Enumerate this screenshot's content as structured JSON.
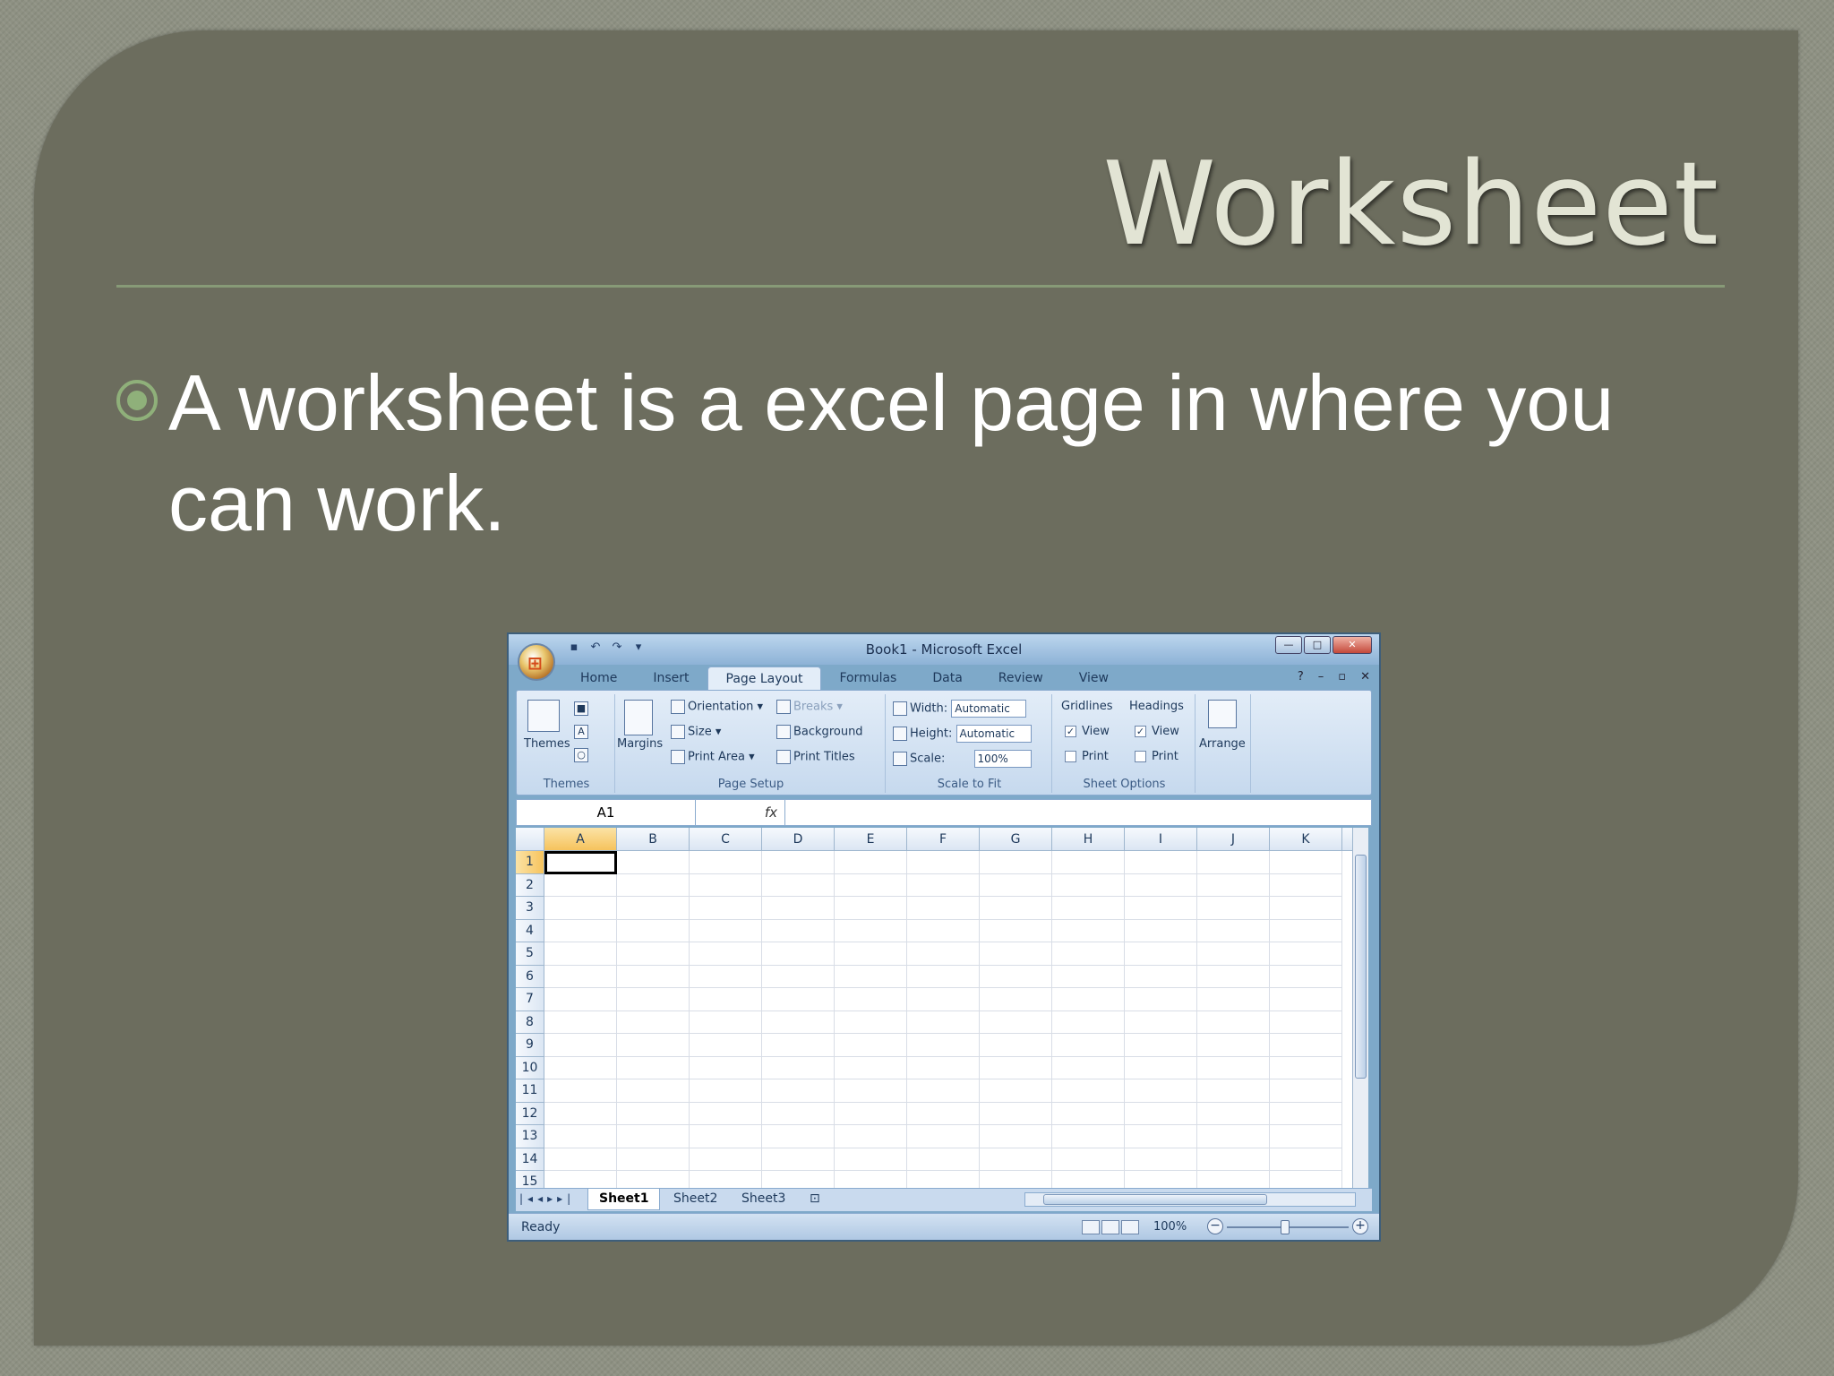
{
  "slide": {
    "title": "Worksheet",
    "bullet_text": "A worksheet is a excel page in where you can work."
  },
  "excel": {
    "window_title": "Book1 - Microsoft Excel",
    "tabs": [
      "Home",
      "Insert",
      "Page Layout",
      "Formulas",
      "Data",
      "Review",
      "View"
    ],
    "active_tab": "Page Layout",
    "ribbon": {
      "themes": {
        "label": "Themes",
        "group": "Themes"
      },
      "page_setup": {
        "margins": "Margins",
        "orientation": "Orientation",
        "size": "Size",
        "print_area": "Print Area",
        "breaks": "Breaks",
        "background": "Background",
        "print_titles": "Print Titles",
        "group": "Page Setup"
      },
      "scale_to_fit": {
        "width_label": "Width:",
        "width_value": "Automatic",
        "height_label": "Height:",
        "height_value": "Automatic",
        "scale_label": "Scale:",
        "scale_value": "100%",
        "group": "Scale to Fit"
      },
      "sheet_options": {
        "gridlines": "Gridlines",
        "headings": "Headings",
        "view": "View",
        "print": "Print",
        "group": "Sheet Options"
      },
      "arrange": {
        "label": "Arrange"
      }
    },
    "name_box": "A1",
    "fx": "fx",
    "columns": [
      "A",
      "B",
      "C",
      "D",
      "E",
      "F",
      "G",
      "H",
      "I",
      "J",
      "K"
    ],
    "rows": [
      "1",
      "2",
      "3",
      "4",
      "5",
      "6",
      "7",
      "8",
      "9",
      "10",
      "11",
      "12",
      "13",
      "14",
      "15"
    ],
    "sheets": [
      "Sheet1",
      "Sheet2",
      "Sheet3"
    ],
    "active_sheet": "Sheet1",
    "status": "Ready",
    "zoom": "100%"
  }
}
